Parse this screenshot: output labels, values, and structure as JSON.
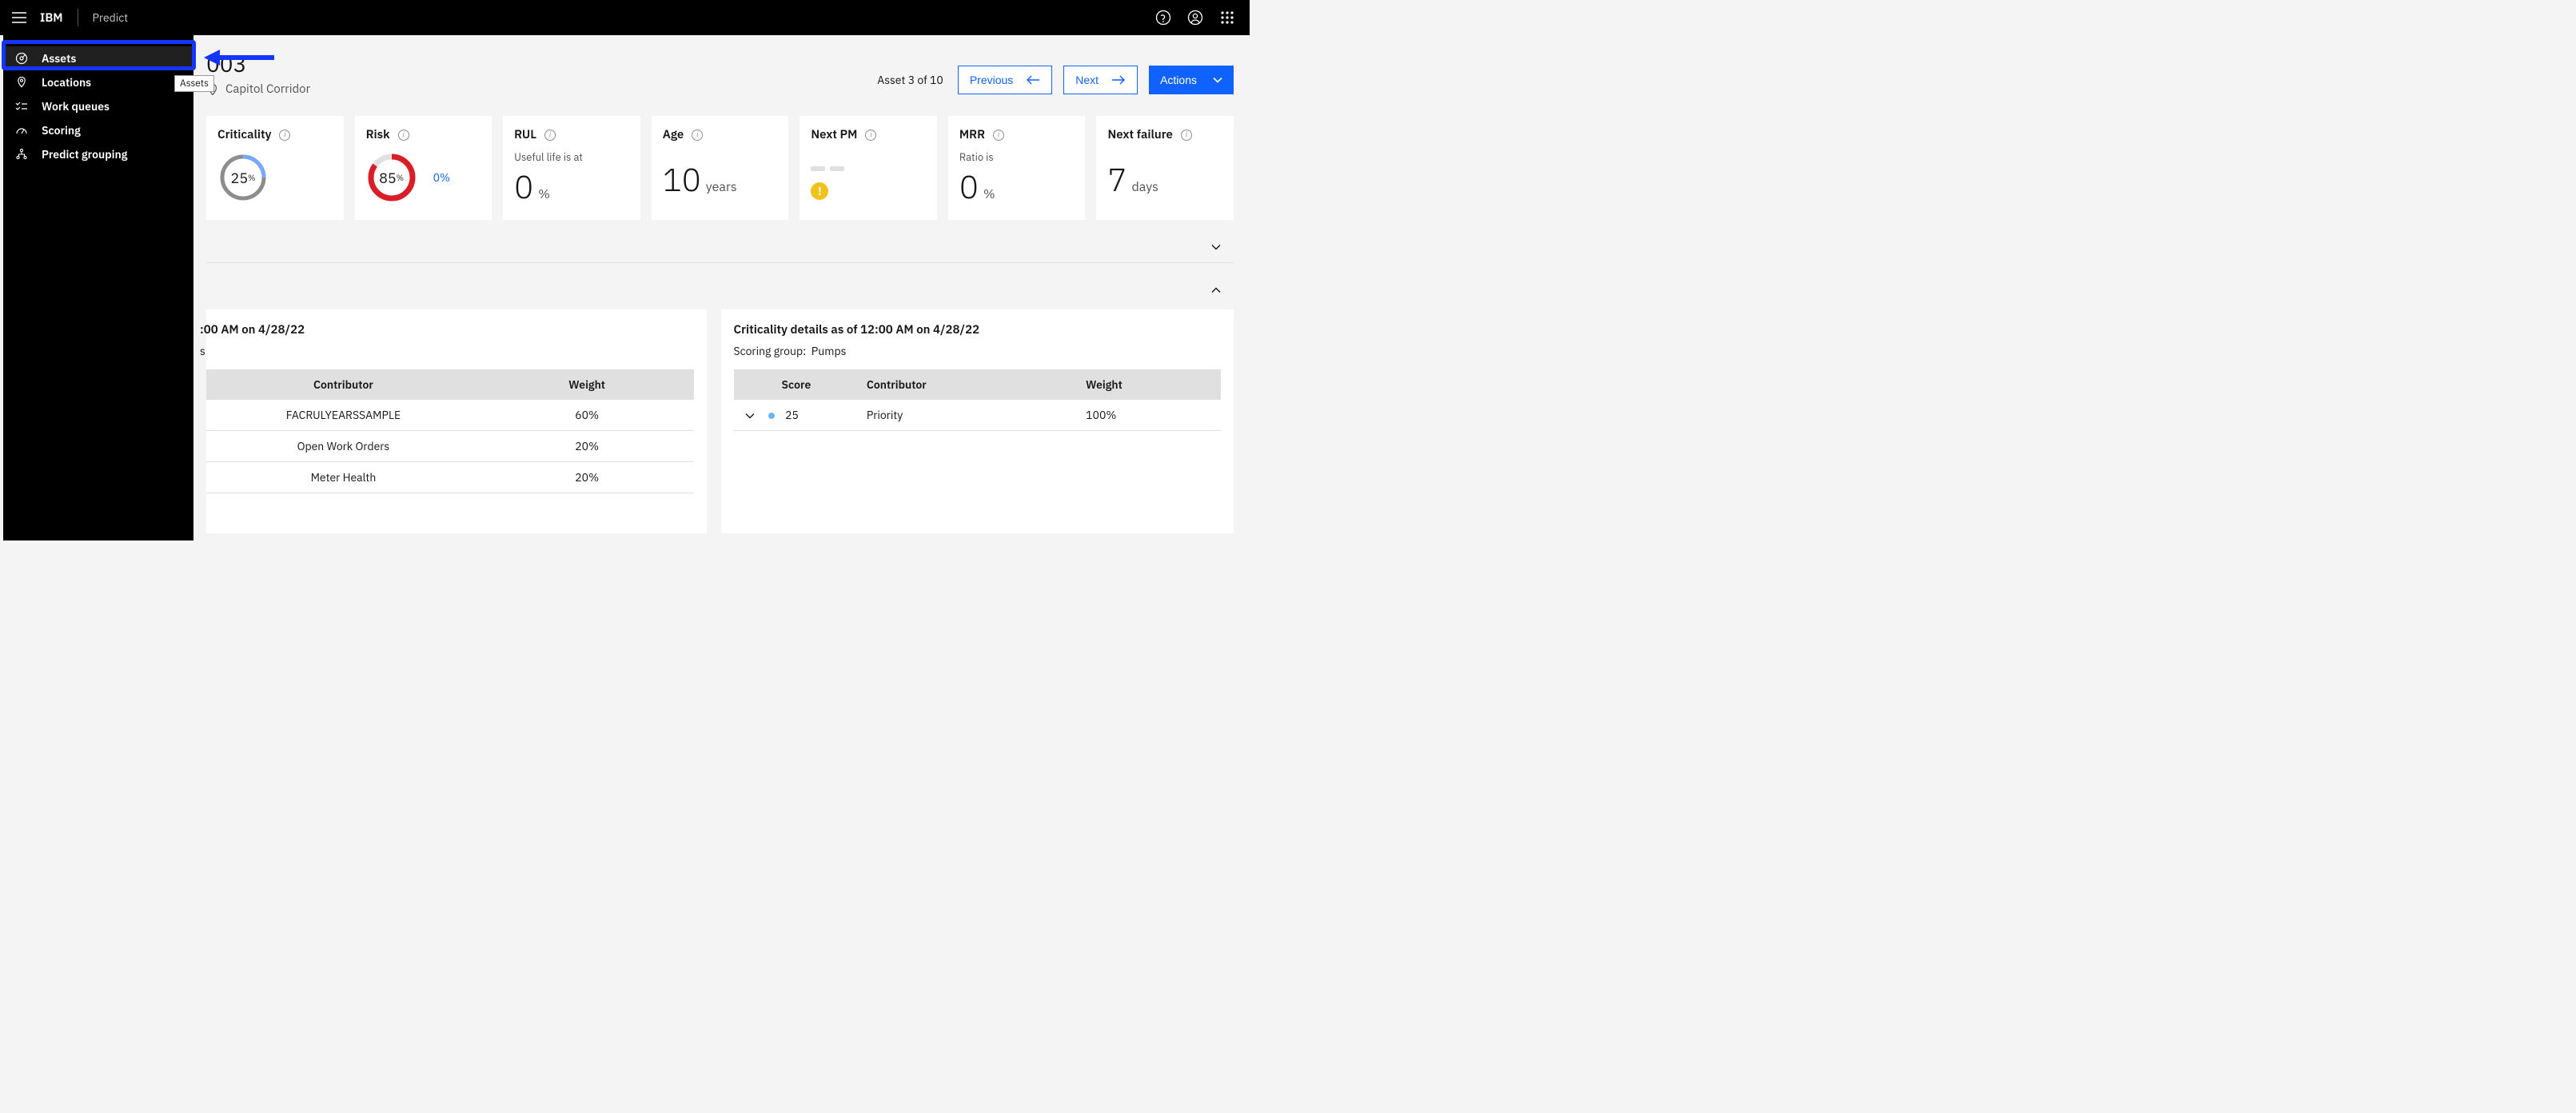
{
  "header": {
    "brand": "IBM",
    "product": "Predict"
  },
  "sidebar": {
    "items": [
      {
        "label": "Assets",
        "icon": "gauge-icon",
        "active": true
      },
      {
        "label": "Locations",
        "icon": "location-pin-icon"
      },
      {
        "label": "Work queues",
        "icon": "checklist-icon"
      },
      {
        "label": "Scoring",
        "icon": "speedometer-icon"
      },
      {
        "label": "Predict grouping",
        "icon": "hierarchy-icon"
      }
    ]
  },
  "tooltip": "Assets",
  "page": {
    "title_fragment": "003",
    "location": "Capitol Corridor",
    "counter": "Asset 3 of 10",
    "previous_label": "Previous",
    "next_label": "Next",
    "actions_label": "Actions"
  },
  "metrics": {
    "criticality": {
      "title": "Criticality",
      "value": "25",
      "unit": "%"
    },
    "risk": {
      "title": "Risk",
      "value": "85",
      "unit": "%",
      "delta": "0%"
    },
    "rul": {
      "title": "RUL",
      "sub": "Useful life is at",
      "value": "0",
      "unit": "%"
    },
    "age": {
      "title": "Age",
      "value": "10",
      "unit": "years"
    },
    "nextpm": {
      "title": "Next PM"
    },
    "mrr": {
      "title": "MRR",
      "sub": "Ratio is",
      "value": "0",
      "unit": "%"
    },
    "nextfail": {
      "title": "Next failure",
      "value": "7",
      "unit": "days"
    }
  },
  "left_panel": {
    "title_fragment": ":00 AM on 4/28/22",
    "scoring_line": "s",
    "columns": {
      "contributor": "Contributor",
      "weight": "Weight"
    },
    "rows": [
      {
        "contributor": "FACRULYEARSSAMPLE",
        "weight": "60%"
      },
      {
        "contributor": "Open Work Orders",
        "weight": "20%"
      },
      {
        "contributor": "Meter Health",
        "weight": "20%"
      }
    ]
  },
  "right_panel": {
    "title": "Criticality details as of 12:00 AM on 4/28/22",
    "scoring_label": "Scoring group:",
    "scoring_value": "Pumps",
    "columns": {
      "score": "Score",
      "contributor": "Contributor",
      "weight": "Weight"
    },
    "rows": [
      {
        "score": "25",
        "contributor": "Priority",
        "weight": "100%"
      }
    ]
  }
}
